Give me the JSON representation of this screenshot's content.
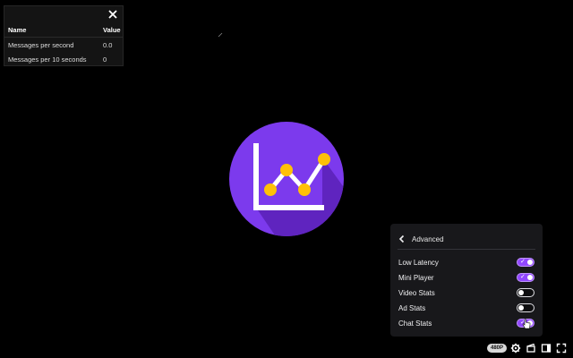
{
  "stats_table": {
    "headers": {
      "name": "Name",
      "value": "Value"
    },
    "rows": [
      {
        "name": "Messages per second",
        "value": "0.0"
      },
      {
        "name": "Messages per 10 seconds",
        "value": "0"
      }
    ]
  },
  "settings_panel": {
    "title": "Advanced",
    "options": [
      {
        "label": "Low Latency",
        "enabled": true
      },
      {
        "label": "Mini Player",
        "enabled": true
      },
      {
        "label": "Video Stats",
        "enabled": false
      },
      {
        "label": "Ad Stats",
        "enabled": false
      },
      {
        "label": "Chat Stats",
        "enabled": true
      }
    ]
  },
  "controls": {
    "quality_badge": "480P",
    "icons": [
      "gear-icon",
      "clip-icon",
      "theatre-mode-icon",
      "fullscreen-icon"
    ]
  },
  "colors": {
    "accent": "#9147ff",
    "logo_purple": "#7c3aed",
    "logo_dot": "#ffc107"
  }
}
